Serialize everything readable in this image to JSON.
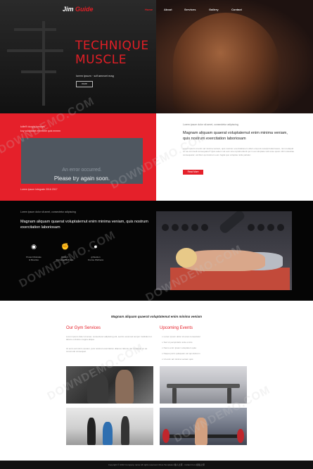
{
  "nav": {
    "logo_first": "Jim",
    "logo_second": "Guide",
    "items": [
      "Home",
      "About",
      "Services",
      "Gallery",
      "Contact"
    ]
  },
  "hero": {
    "title_line1": "TECHNIQUE",
    "title_line2": "MUSCLE",
    "subtitle": "lorem ipsum · sdf amecet mag",
    "button": "more"
  },
  "red_panel": {
    "line1": "kdfef!! dcogisi ismorps",
    "line2": "kuy vuloptaset mnmtone quis mmmn",
    "video_error_1": "An error occurred.",
    "video_error_2": "Please try again soon.",
    "caption": "Lorem ipsum Integrate 2016 2017"
  },
  "white_panel": {
    "kicker": "Lorem ipsum dolor sit amet, consectetur adipiscing",
    "heading": "Magnam aliquam quaerat voluptatemut enim minima veniam, quis nostrum exercitation laboriosam",
    "body": "Lorem ipsum ut enim ad minima veniam, quis nostrum exercitationem ullam corporis suscipit laboriosam, nisi ut aliquid ex ea commodi consequatur? Quis autem vel eum iure reprehenderit qui in ea voluptate velit esse quam nihil molestiae consequatur, vel illum qui dolorem eum fugiat quo voluptas nulla pariatur.",
    "button": "Read More"
  },
  "black_band": {
    "kicker": "Lorem ipsum dolor sit amet, consectetur adipiscing",
    "heading": "Magnam aliquam quaerat voluptatemut enim minima veniam, quis nostrum exercitation laboriosam",
    "features": [
      {
        "icon": "gym-icon",
        "line1": "Proiect Motivate",
        "line2": "& Muscles"
      },
      {
        "icon": "boxing-icon",
        "line1": "Proiect",
        "line2": "Personal Wellness"
      },
      {
        "icon": "strength-icon",
        "line1": "gribustion",
        "line2": "Fourse Wellness"
      }
    ]
  },
  "services": {
    "heading": "Magnam aliquam quaerat voluptatemut enim minima veniam",
    "col1_title": "Our Gym Services",
    "col1_body_1": "Lorem ipsum dolor sit amet, consectetur adipiscing elit, sed do eiusmod tempor incididunt ut labore et dolore magna aliqua.",
    "col1_body_2": "Ut enim ad minim veniam, quis nostrud exercitation ullamco laboris nisi ut aliquip ex ea commodo consequat.",
    "col2_title": "Upcoming Events",
    "events": [
      "Lorem ipsum dolor sit amet consectetur",
      "Sed ut perspiciatis unde omnis",
      "Nemo enim ipsam voluptatem quia",
      "Neque porro quisquam est qui dolorem",
      "Ut enim ad minima veniam quis"
    ]
  },
  "footer": {
    "text": "Copyright © 2016 Company name All rights reserved. More Templates 懒人之家 - Collect from 模板之家"
  },
  "watermark": "DOWNDEMO.COM"
}
